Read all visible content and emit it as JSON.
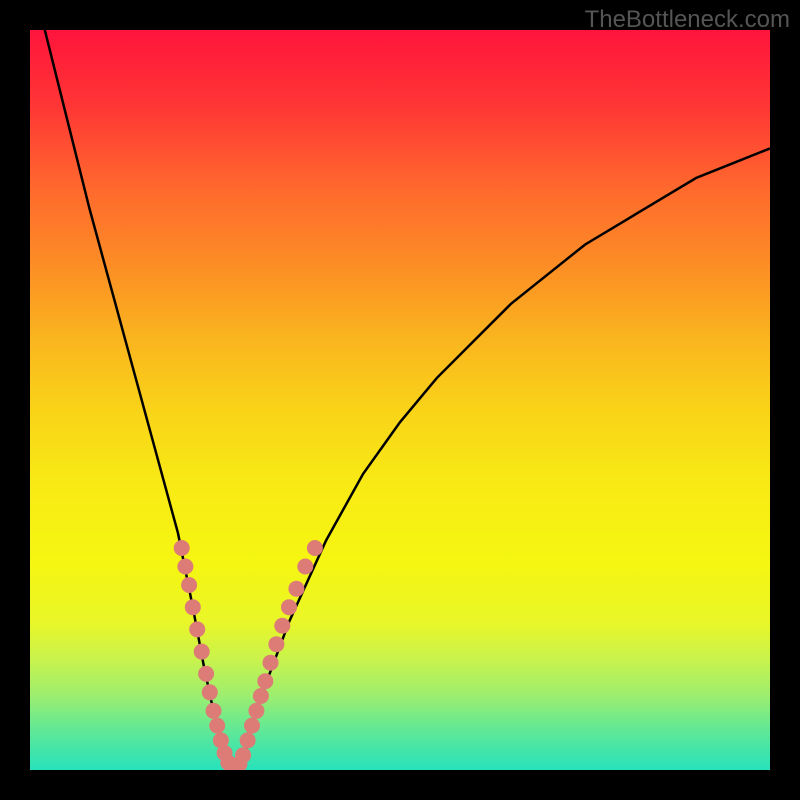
{
  "watermark": "TheBottleneck.com",
  "chart_data": {
    "type": "line",
    "title": "",
    "xlabel": "",
    "ylabel": "",
    "xlim": [
      0,
      100
    ],
    "ylim": [
      0,
      100
    ],
    "grid": false,
    "series": [
      {
        "name": "bottleneck-curve",
        "x": [
          2,
          5,
          8,
          11,
          14,
          17,
          20,
          22,
          23.5,
          25,
          26,
          27,
          28,
          29,
          30,
          32,
          35,
          40,
          45,
          50,
          55,
          60,
          65,
          70,
          75,
          80,
          85,
          90,
          95,
          100
        ],
        "y": [
          100,
          88,
          76,
          65,
          54,
          43,
          32,
          22,
          14,
          7,
          2,
          0,
          0,
          2,
          6,
          12,
          20,
          31,
          40,
          47,
          53,
          58,
          63,
          67,
          71,
          74,
          77,
          80,
          82,
          84
        ]
      }
    ],
    "markers": {
      "name": "highlight-dots",
      "color": "#dd7c77",
      "points": [
        {
          "x": 20.5,
          "y": 30
        },
        {
          "x": 21.0,
          "y": 27.5
        },
        {
          "x": 21.5,
          "y": 25
        },
        {
          "x": 22.0,
          "y": 22
        },
        {
          "x": 22.6,
          "y": 19
        },
        {
          "x": 23.2,
          "y": 16
        },
        {
          "x": 23.8,
          "y": 13
        },
        {
          "x": 24.3,
          "y": 10.5
        },
        {
          "x": 24.8,
          "y": 8
        },
        {
          "x": 25.3,
          "y": 6
        },
        {
          "x": 25.8,
          "y": 4
        },
        {
          "x": 26.3,
          "y": 2.3
        },
        {
          "x": 26.8,
          "y": 1.0
        },
        {
          "x": 27.3,
          "y": 0.3
        },
        {
          "x": 27.8,
          "y": 0.2
        },
        {
          "x": 28.3,
          "y": 0.8
        },
        {
          "x": 28.8,
          "y": 2.0
        },
        {
          "x": 29.4,
          "y": 4.0
        },
        {
          "x": 30.0,
          "y": 6.0
        },
        {
          "x": 30.6,
          "y": 8.0
        },
        {
          "x": 31.2,
          "y": 10.0
        },
        {
          "x": 31.8,
          "y": 12.0
        },
        {
          "x": 32.5,
          "y": 14.5
        },
        {
          "x": 33.3,
          "y": 17.0
        },
        {
          "x": 34.1,
          "y": 19.5
        },
        {
          "x": 35.0,
          "y": 22.0
        },
        {
          "x": 36.0,
          "y": 24.5
        },
        {
          "x": 37.2,
          "y": 27.5
        },
        {
          "x": 38.5,
          "y": 30.0
        }
      ]
    },
    "gradient_stops": [
      {
        "pos": 0.0,
        "color": "#ff143c"
      },
      {
        "pos": 0.5,
        "color": "#f9d518"
      },
      {
        "pos": 1.0,
        "color": "#28e2bb"
      }
    ]
  }
}
